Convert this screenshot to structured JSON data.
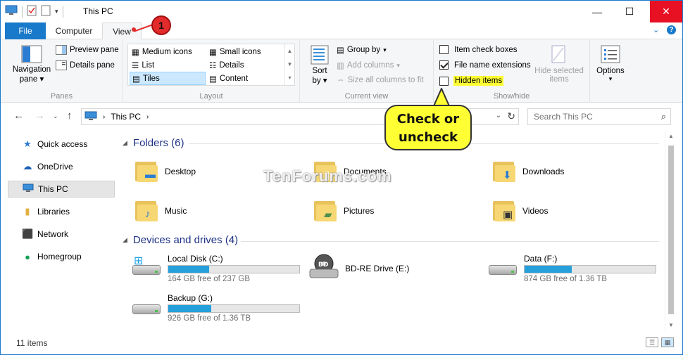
{
  "window": {
    "title": "This PC"
  },
  "tabs": {
    "file": "File",
    "computer": "Computer",
    "view": "View"
  },
  "ribbon": {
    "panes": {
      "label": "Panes",
      "navigation_pane": "Navigation",
      "navigation_pane_2": "pane",
      "preview_pane": "Preview pane",
      "details_pane": "Details pane"
    },
    "layout": {
      "label": "Layout",
      "items": [
        "Medium icons",
        "Small icons",
        "List",
        "Details",
        "Tiles",
        "Content"
      ]
    },
    "current_view": {
      "label": "Current view",
      "sort_by": "Sort",
      "sort_by_2": "by",
      "group_by": "Group by",
      "add_columns": "Add columns",
      "size_all_columns": "Size all columns to fit"
    },
    "show_hide": {
      "label": "Show/hide",
      "item_check_boxes": "Item check boxes",
      "file_name_extensions": "File name extensions",
      "hidden_items": "Hidden items",
      "hide_selected_items": "Hide selected",
      "hide_selected_items_2": "items"
    },
    "options": {
      "label": "Options"
    }
  },
  "addressbar": {
    "path": "This PC",
    "search_placeholder": "Search This PC"
  },
  "sidebar": {
    "items": [
      "Quick access",
      "OneDrive",
      "This PC",
      "Libraries",
      "Network",
      "Homegroup"
    ]
  },
  "folders": {
    "heading": "Folders (6)",
    "items": [
      "Desktop",
      "Documents",
      "Downloads",
      "Music",
      "Pictures",
      "Videos"
    ]
  },
  "drives": {
    "heading": "Devices and drives (4)",
    "items": [
      {
        "name": "Local Disk (C:)",
        "free": "164 GB free of 237 GB",
        "used_fraction": 0.31
      },
      {
        "name": "BD-RE Drive (E:)"
      },
      {
        "name": "Data (F:)",
        "free": "874 GB free of 1.36 TB",
        "used_fraction": 0.36
      },
      {
        "name": "Backup (G:)",
        "free": "926 GB free of 1.36 TB",
        "used_fraction": 0.33
      }
    ]
  },
  "status": {
    "count": "11 items"
  },
  "annotations": {
    "callout_line1": "Check or",
    "callout_line2": "uncheck",
    "step": "1",
    "watermark": "TenForums.com"
  },
  "colors": {
    "accent": "#1979ca",
    "highlight": "#ffff33",
    "bar": "#26a0da",
    "close": "#e81123"
  }
}
